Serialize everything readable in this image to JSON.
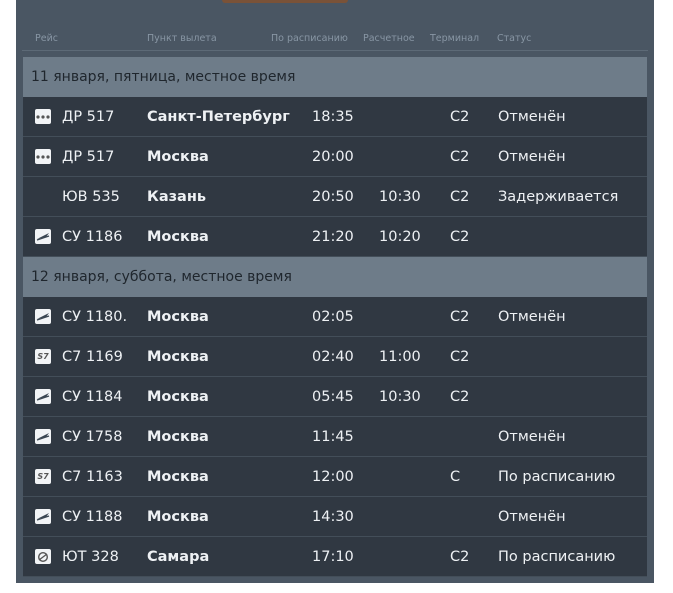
{
  "columns": {
    "flight": "Рейс",
    "departure_point": "Пункт вылета",
    "scheduled": "По расписанию",
    "estimated": "Расчетное",
    "terminal": "Терминал",
    "status": "Статус"
  },
  "groups": [
    {
      "date": "11 января, пятница, местное время",
      "flights": [
        {
          "logo": "dots-airline-icon",
          "number": "ДР 517",
          "city": "Санкт-Петербург",
          "scheduled": "18:35",
          "estimated": "",
          "terminal": "C2",
          "status": "Отменён"
        },
        {
          "logo": "dots-airline-icon",
          "number": "ДР 517",
          "city": "Москва",
          "scheduled": "20:00",
          "estimated": "",
          "terminal": "C2",
          "status": "Отменён"
        },
        {
          "logo": "",
          "number": "ЮВ 535",
          "city": "Казань",
          "scheduled": "20:50",
          "estimated": "10:30",
          "terminal": "C2",
          "status": "Задерживается"
        },
        {
          "logo": "aeroflot-icon",
          "number": "СУ 1186",
          "city": "Москва",
          "scheduled": "21:20",
          "estimated": "10:20",
          "terminal": "C2",
          "status": ""
        }
      ]
    },
    {
      "date": "12 января, суббота, местное время",
      "flights": [
        {
          "logo": "aeroflot-icon",
          "number": "СУ 1180.",
          "city": "Москва",
          "scheduled": "02:05",
          "estimated": "",
          "terminal": "C2",
          "status": "Отменён"
        },
        {
          "logo": "s7-icon",
          "number": "С7 1169",
          "city": "Москва",
          "scheduled": "02:40",
          "estimated": "11:00",
          "terminal": "C2",
          "status": ""
        },
        {
          "logo": "aeroflot-icon",
          "number": "СУ 1184",
          "city": "Москва",
          "scheduled": "05:45",
          "estimated": "10:30",
          "terminal": "C2",
          "status": ""
        },
        {
          "logo": "aeroflot-icon",
          "number": "СУ 1758",
          "city": "Москва",
          "scheduled": "11:45",
          "estimated": "",
          "terminal": "",
          "status": "Отменён"
        },
        {
          "logo": "s7-icon",
          "number": "С7 1163",
          "city": "Москва",
          "scheduled": "12:00",
          "estimated": "",
          "terminal": "C",
          "status": "По расписанию"
        },
        {
          "logo": "aeroflot-icon",
          "number": "СУ 1188",
          "city": "Москва",
          "scheduled": "14:30",
          "estimated": "",
          "terminal": "",
          "status": "Отменён"
        },
        {
          "logo": "utair-icon",
          "number": "ЮТ 328",
          "city": "Самара",
          "scheduled": "17:10",
          "estimated": "",
          "terminal": "C2",
          "status": "По расписанию"
        }
      ]
    }
  ],
  "colors": {
    "panel": "#4a5663",
    "date_row": "#6e7c89",
    "flight_row": "#303842",
    "text": "#eef1f4"
  }
}
